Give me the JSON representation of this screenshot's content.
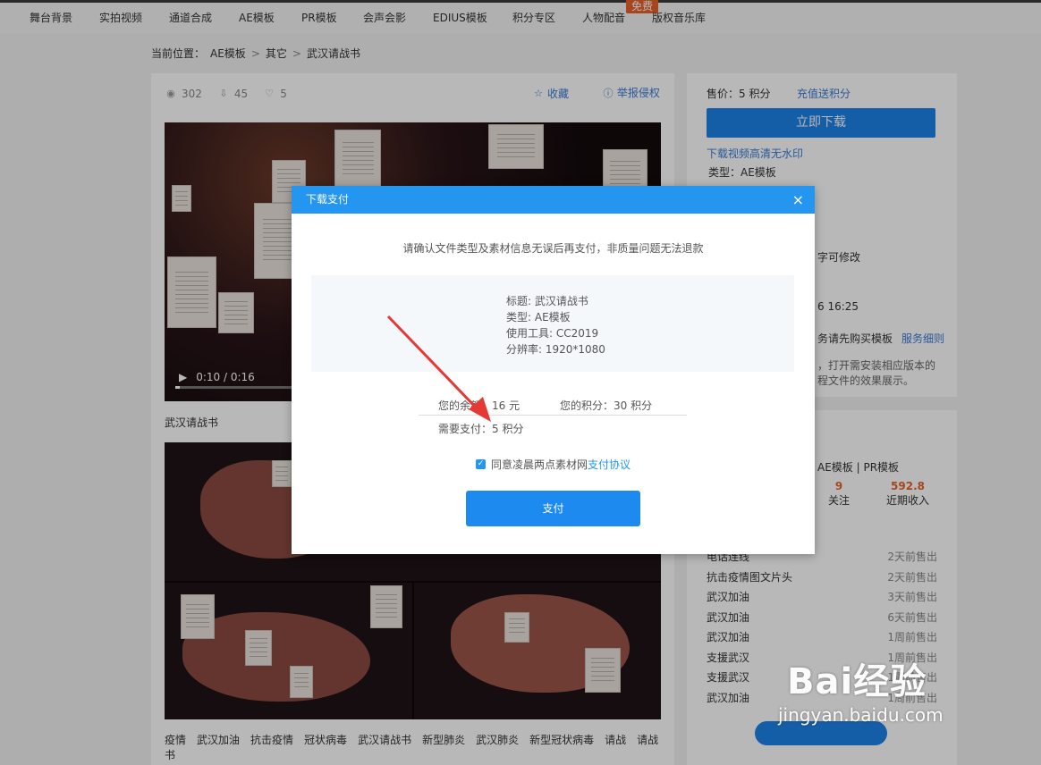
{
  "nav": {
    "items": [
      "舞台背景",
      "实拍视频",
      "通道合成",
      "AE模板",
      "PR模板",
      "会声会影",
      "EDIUS模板",
      "积分专区",
      "人物配音",
      "版权音乐库"
    ],
    "free_badge": "免费"
  },
  "breadcrumb": {
    "label": "当前位置：",
    "items": [
      "AE模板",
      "其它",
      "武汉请战书"
    ],
    "separator": ">"
  },
  "detail": {
    "views": "302",
    "downloads": "45",
    "likes": "5",
    "favorite": "收藏",
    "report": "举报侵权",
    "video_time": "0:10 / 0:16",
    "video_progress": 0.01,
    "title": "武汉请战书",
    "tags": [
      "疫情",
      "武汉加油",
      "抗击疫情",
      "冠状病毒",
      "武汉请战书",
      "新型肺炎",
      "武汉肺炎",
      "新型冠状病毒",
      "请战",
      "请战书"
    ]
  },
  "sidebar": {
    "price_label": "售价：",
    "price_value": "5 积分",
    "recharge": "充值送积分",
    "download_button": "立即下载",
    "hd_link": "下载视频高清无水印",
    "type_line": "类型：AE模板",
    "partial_lines": [
      "字可修改",
      "6 16:25"
    ],
    "service_text": "务请先购买模板",
    "service_link": "服务细则",
    "note_lines": [
      "，打开需安装相应版本的",
      "程文件的效果展示。"
    ]
  },
  "author": {
    "categories": "AE模板 | PR模板",
    "follow_count": "9",
    "follow_label": "关注",
    "income_value": "592.8",
    "income_label": "近期收入",
    "sales": [
      {
        "name": "电话连线",
        "time": "2天前售出"
      },
      {
        "name": "抗击疫情图文片头",
        "time": "2天前售出"
      },
      {
        "name": "武汉加油",
        "time": "3天前售出"
      },
      {
        "name": "武汉加油",
        "time": "6天前售出"
      },
      {
        "name": "武汉加油",
        "time": "1周前售出"
      },
      {
        "name": "支援武汉",
        "time": "1周前售出"
      },
      {
        "name": "支援武汉",
        "time": "1周前售出"
      },
      {
        "name": "武汉加油",
        "time": "1周前售出"
      }
    ]
  },
  "modal": {
    "title": "下载支付",
    "close": "×",
    "notice": "请确认文件类型及素材信息无误后再支付，非质量问题无法退款",
    "info": {
      "title_line": "标题: 武汉请战书",
      "type_line": "类型: AE模板",
      "tool_line": "使用工具: CC2019",
      "resolution_line": "分辨率: 1920*1080"
    },
    "balance": "您的余额：16 元",
    "points": "您的积分：30 积分",
    "need_pay": "需要支付：5 积分",
    "agree_text": "同意凌晨两点素材网",
    "agree_link": "支付协议",
    "pay_button": "支付"
  },
  "watermark": {
    "brand": "Bai经验",
    "url": "jingyan.baidu.com"
  },
  "colors": {
    "accent": "#1d82e8",
    "badge": "#e8622a",
    "modal_header": "#2596ef",
    "arrow": "#e53935"
  }
}
